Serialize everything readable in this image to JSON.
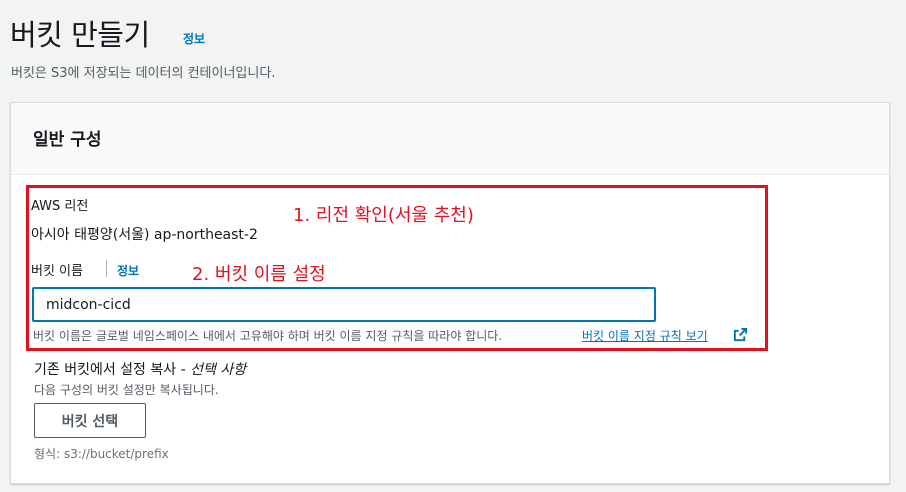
{
  "header": {
    "title": "버킷 만들기",
    "info_link": "정보",
    "description": "버킷은 S3에 저장되는 데이터의 컨테이너입니다."
  },
  "general": {
    "title": "일반 구성",
    "region_label": "AWS 리전",
    "region_value": "아시아 태평양(서울) ap-northeast-2",
    "bucket_name_label": "버킷 이름",
    "bucket_name_info": "정보",
    "bucket_name_value": "midcon-cicd",
    "bucket_name_constraint": "버킷 이름은 글로벌 네임스페이스 내에서 고유해야 하며 버킷 이름 지정 규칙을 따라야 합니다.",
    "rules_link": "버킷 이름 지정 규칙 보기",
    "copy_settings_title": "기존 버킷에서 설정 복사 - ",
    "copy_settings_optional": "선택 사항",
    "copy_settings_desc": "다음 구성의 버킷 설정만 복사됩니다.",
    "choose_bucket_button": "버킷 선택",
    "format_hint": "형식: s3://bucket/prefix"
  },
  "annotations": {
    "step1": "1. 리전 확인(서울 추천)",
    "step2": "2. 버킷 이름 설정"
  },
  "colors": {
    "accent_link": "#0073bb",
    "annotation_red": "#e3111f",
    "background": "#f2f3f3"
  }
}
